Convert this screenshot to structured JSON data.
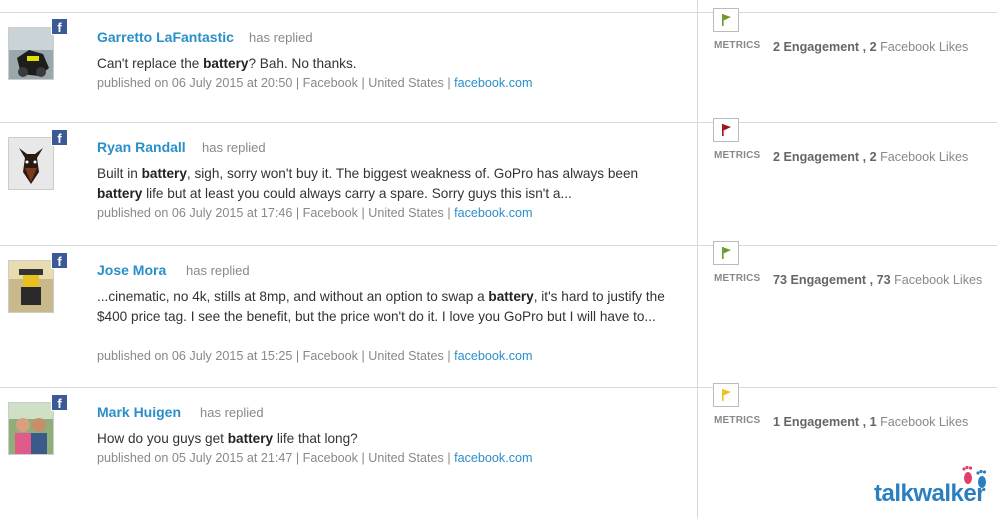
{
  "colors": {
    "flag_green": "#6a9a2a",
    "flag_red": "#a01010",
    "flag_yellow": "#f0c020",
    "facebook": "#3b5998",
    "link": "#2a8fc9"
  },
  "posts": [
    {
      "author": "Garretto LaFantastic",
      "action": "has replied",
      "text_before": "Can't replace the ",
      "bold1": "battery",
      "text_after": "? Bah. No thanks.",
      "published": "published on 06 July 2015 at 20:50 |",
      "source": "Facebook |",
      "country": "United States |",
      "link": "facebook.com",
      "flag": "green",
      "metrics_label": "METRICS",
      "engagement_num": "2",
      "engagement_label": "Engagement ,",
      "likes_num": "2",
      "likes_label": "Facebook Likes"
    },
    {
      "author": "Ryan Randall",
      "action": "has replied",
      "text_a": "Built in ",
      "bold1": "battery",
      "text_b": ", sigh, sorry won't buy it. The biggest weakness of. GoPro has always been",
      "bold2": "battery",
      "text_c": " life but at least you could always carry a spare. Sorry guys this isn't a...",
      "published": "published on 06 July 2015 at 17:46 |",
      "source": "Facebook |",
      "country": "United States |",
      "link": "facebook.com",
      "flag": "red",
      "metrics_label": "METRICS",
      "engagement_num": "2",
      "engagement_label": "Engagement ,",
      "likes_num": "2",
      "likes_label": "Facebook Likes"
    },
    {
      "author": "Jose Mora",
      "action": "has replied",
      "text_a": "...cinematic, no 4k, stills at 8mp, and without an option to swap a ",
      "bold1": "battery",
      "text_b": ", it's hard to justify the $400 price tag. I see the benefit, but the price won't do it. I love you GoPro but I will have to...",
      "published": "published on 06 July 2015 at 15:25 |",
      "source": "Facebook |",
      "country": "United States |",
      "link": "facebook.com",
      "flag": "green",
      "metrics_label": "METRICS",
      "engagement_num": "73",
      "engagement_label": "Engagement ,",
      "likes_num": "73",
      "likes_label": "Facebook Likes"
    },
    {
      "author": "Mark Huigen",
      "action": "has replied",
      "text_a": "How do you guys get ",
      "bold1": "battery",
      "text_b": " life that long?",
      "published": "published on 05 July 2015 at 21:47 |",
      "source": "Facebook |",
      "country": "United States |",
      "link": "facebook.com",
      "flag": "yellow",
      "metrics_label": "METRICS",
      "engagement_num": "1",
      "engagement_label": "Engagement ,",
      "likes_num": "1",
      "likes_label": "Facebook Likes"
    }
  ],
  "brand": {
    "part1": "talk",
    "part2": "walker"
  }
}
